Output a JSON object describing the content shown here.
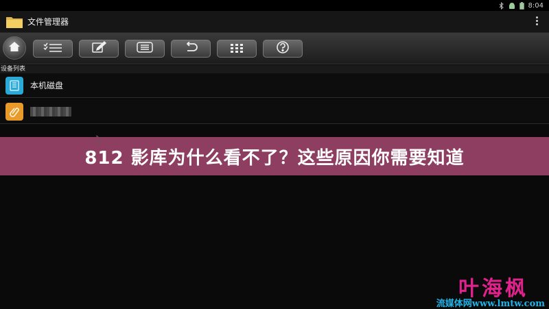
{
  "status_bar": {
    "time": "8:04"
  },
  "app_bar": {
    "title": "文件管理器"
  },
  "toolbar": {
    "buttons": [
      {
        "icon": "check-list-icon"
      },
      {
        "icon": "edit-icon"
      },
      {
        "icon": "list-icon"
      },
      {
        "icon": "undo-icon"
      },
      {
        "icon": "grid-icon"
      },
      {
        "icon": "help-icon"
      }
    ]
  },
  "device_list": {
    "label": "设备列表",
    "items": [
      {
        "label": "本机磁盘",
        "icon": "disk-icon"
      },
      {
        "label": "",
        "icon": "usb-drive-icon"
      }
    ]
  },
  "banner": {
    "text": "812 影库为什么看不了？这些原因你需要知道"
  },
  "watermark": {
    "main": "叶海枫",
    "sub": "流媒体网www.lmtw.com"
  },
  "colors": {
    "banner": "#8e3f61",
    "watermark_main": "#e0238c",
    "watermark_sub": "#1fb3e8",
    "disk_icon": "#2aa9d6",
    "usb_icon": "#e89a2a"
  }
}
